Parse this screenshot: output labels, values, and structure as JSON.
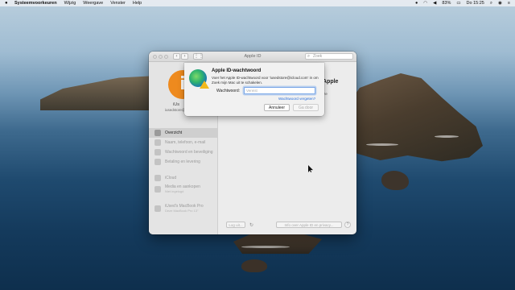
{
  "menubar": {
    "app_name": "Systeemvoorkeuren",
    "items": [
      "Wijzig",
      "Weergave",
      "Venster",
      "Help"
    ],
    "battery": "83%",
    "clock": "Do 15:25"
  },
  "window": {
    "title": "Apple ID",
    "search_placeholder": "Zoek"
  },
  "sidebar": {
    "avatar_letter": "i",
    "user_name": "iUs",
    "user_email": "iusedstore@i",
    "items": [
      {
        "label": "Overzicht",
        "selected": true
      },
      {
        "label": "Naam, telefoon, e-mail"
      },
      {
        "label": "Wachtwoord en beveiliging"
      },
      {
        "label": "Betaling en levering"
      },
      {
        "label": "iCloud"
      },
      {
        "label": "Media en aankopen",
        "sub": "Niet ingelogd"
      },
      {
        "label": "iUsed's MacBook Pro",
        "sub": "Deze MacBook Pro 13\""
      }
    ]
  },
  "main": {
    "heading": "Apple",
    "text": "deze"
  },
  "bottom": {
    "logout_label": "Log uit...",
    "info_label": "Info over Apple ID en privacy...",
    "help_label": "?"
  },
  "sheet": {
    "title": "Apple ID-wachtwoord",
    "description": "Voer het Apple ID-wachtwoord voor 'iusedstore@icloud.com' in om Zoek mijn Mac uit te schakelen.",
    "password_label": "Wachtwoord:",
    "password_placeholder": "Vereist",
    "forgot_link": "Wachtwoord vergeten?",
    "cancel_label": "Annuleer",
    "next_label": "Ga door"
  }
}
